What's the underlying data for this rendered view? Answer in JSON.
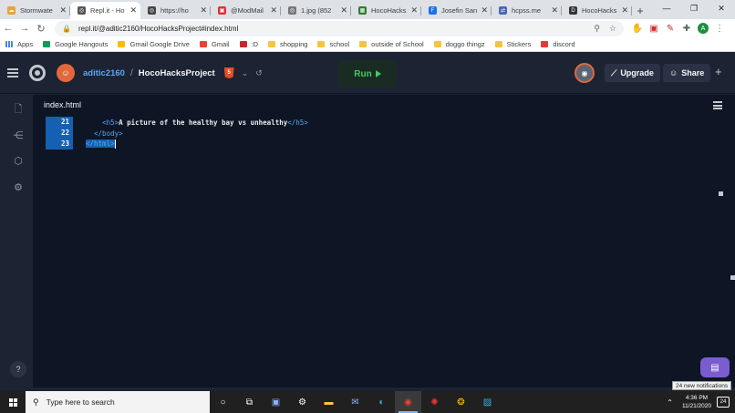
{
  "browser": {
    "tabs": [
      {
        "title": "Stormwate",
        "color": "#e8a33b",
        "glyph": "☁"
      },
      {
        "title": "Repl.it - Ho",
        "color": "#555",
        "glyph": "◎"
      },
      {
        "title": "https://ho",
        "color": "#444",
        "glyph": "◎"
      },
      {
        "title": "@ModMail",
        "color": "#d33",
        "glyph": "▣"
      },
      {
        "title": "1.jpg (852",
        "color": "#777",
        "glyph": "◎"
      },
      {
        "title": "HocoHacks",
        "color": "#2f7d32",
        "glyph": "▦"
      },
      {
        "title": "Josefin San",
        "color": "#1a73e8",
        "glyph": "F"
      },
      {
        "title": "hcpss.me",
        "color": "#4a67b1",
        "glyph": "⇄"
      },
      {
        "title": "HocoHacks",
        "color": "#333",
        "glyph": "D"
      }
    ],
    "active_tab": 1,
    "url": "repl.it/@aditic2160/HocoHacksProject#index.html",
    "new_tab": "+",
    "window_controls": {
      "minimize": "—",
      "maximize": "❐",
      "close": "✕"
    },
    "nav": {
      "back": "←",
      "forward": "→",
      "reload": "↻"
    },
    "profile_initial": "A"
  },
  "bookmarks": [
    {
      "label": "Apps",
      "type": "apps",
      "color": "#4285f4"
    },
    {
      "label": "Google Hangouts",
      "type": "site",
      "color": "#0f9d58"
    },
    {
      "label": "Gmail Google Drive",
      "type": "site",
      "color": "#fbbc04"
    },
    {
      "label": "Gmail",
      "type": "site",
      "color": "#ea4335"
    },
    {
      "label": ":D",
      "type": "site",
      "color": "#c62828"
    },
    {
      "label": "shopping",
      "type": "folder",
      "color": "#f5c542"
    },
    {
      "label": "school",
      "type": "folder",
      "color": "#f5c542"
    },
    {
      "label": "outside of School",
      "type": "folder",
      "color": "#f5c542"
    },
    {
      "label": "doggo thingz",
      "type": "folder",
      "color": "#f5c542"
    },
    {
      "label": "Stickers",
      "type": "folder",
      "color": "#f5c542"
    },
    {
      "label": "discord",
      "type": "site",
      "color": "#e53935"
    }
  ],
  "replit": {
    "username": "aditic2160",
    "separator": "/",
    "project": "HocoHacksProject",
    "run_label": "Run",
    "upgrade_label": "Upgrade",
    "share_label": "Share",
    "plus": "+",
    "help": "?"
  },
  "editor": {
    "file_tab": "index.html",
    "lines": [
      {
        "num": "21",
        "indent": "    ",
        "open": "<h5>",
        "text": "A picture of the healthy bay vs unhealthy",
        "close": "</h5>"
      },
      {
        "num": "22",
        "indent": "  ",
        "open": "</body>",
        "text": "",
        "close": ""
      },
      {
        "num": "23",
        "indent": "",
        "open": "</html>",
        "text": "",
        "close": ""
      }
    ]
  },
  "notification": "24 new notifications",
  "taskbar": {
    "search_placeholder": "Type here to search",
    "time": "4:36 PM",
    "date": "11/21/2020",
    "notif_count": "24"
  }
}
